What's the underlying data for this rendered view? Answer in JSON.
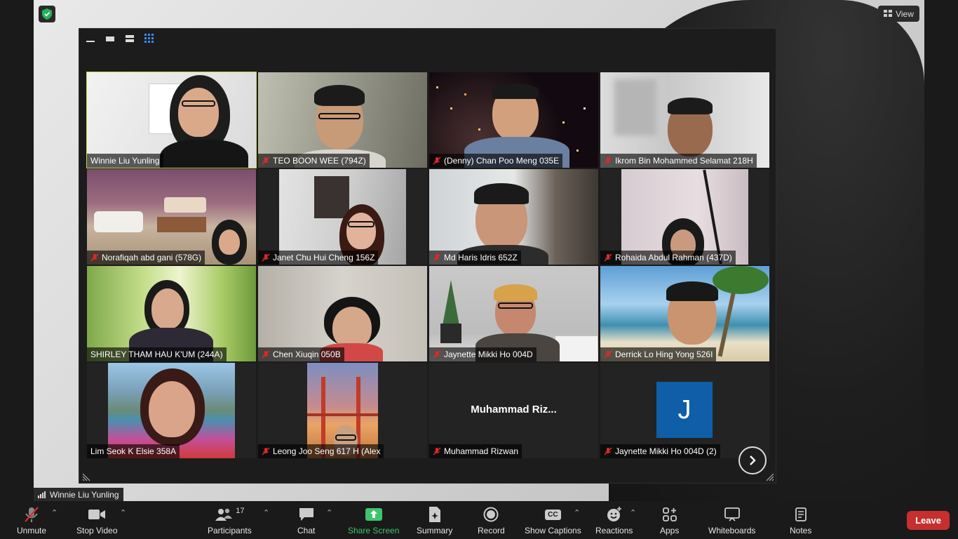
{
  "meeting": {
    "view_label": "View",
    "self_name": "Winnie Liu Yunling"
  },
  "tiles": [
    {
      "name": "Winnie Liu Yunling",
      "muted": false,
      "active": true
    },
    {
      "name": "TEO BOON WEE (794Z)",
      "muted": true
    },
    {
      "name": "(Denny) Chan Poo Meng 035E",
      "muted": true
    },
    {
      "name": "Ikrom Bin Mohammed Selamat 218H",
      "muted": true
    },
    {
      "name": "Norafiqah abd gani  (578G)",
      "muted": true
    },
    {
      "name": "Janet Chu Hui Cheng 156Z",
      "muted": true
    },
    {
      "name": "Md Haris Idris 652Z",
      "muted": true
    },
    {
      "name": "Rohaida Abdul Rahman  (437D)",
      "muted": true
    },
    {
      "name": "SHIRLEY THAM HAU K'UM (244A)",
      "muted": false
    },
    {
      "name": "Chen Xiuqin 050B",
      "muted": true
    },
    {
      "name": "Jaynette Mikki Ho 004D",
      "muted": true
    },
    {
      "name": "Derrick Lo Hing Yong 526I",
      "muted": true
    },
    {
      "name": "Lim Seok K Elsie 358A",
      "muted": false
    },
    {
      "name": "Leong Joo Seng 617 H (Alex",
      "muted": true
    },
    {
      "name": "Muhammad Rizwan",
      "muted": true,
      "center_text": "Muhammad  Riz..."
    },
    {
      "name": "Jaynette Mikki Ho 004D (2)",
      "muted": true,
      "avatar_letter": "J"
    }
  ],
  "toolbar": {
    "unmute": "Unmute",
    "stop_video": "Stop Video",
    "participants": "Participants",
    "participants_count": "17",
    "chat": "Chat",
    "share_screen": "Share Screen",
    "summary": "Summary",
    "record": "Record",
    "show_captions": "Show Captions",
    "captions_icon_text": "CC",
    "reactions": "Reactions",
    "apps": "Apps",
    "whiteboards": "Whiteboards",
    "notes": "Notes",
    "leave": "Leave"
  },
  "colors": {
    "accent_green": "#3ec46d",
    "leave_red": "#c72f2f",
    "active_speaker": "#c9d53a",
    "avatar_blue": "#0e5fa8"
  }
}
